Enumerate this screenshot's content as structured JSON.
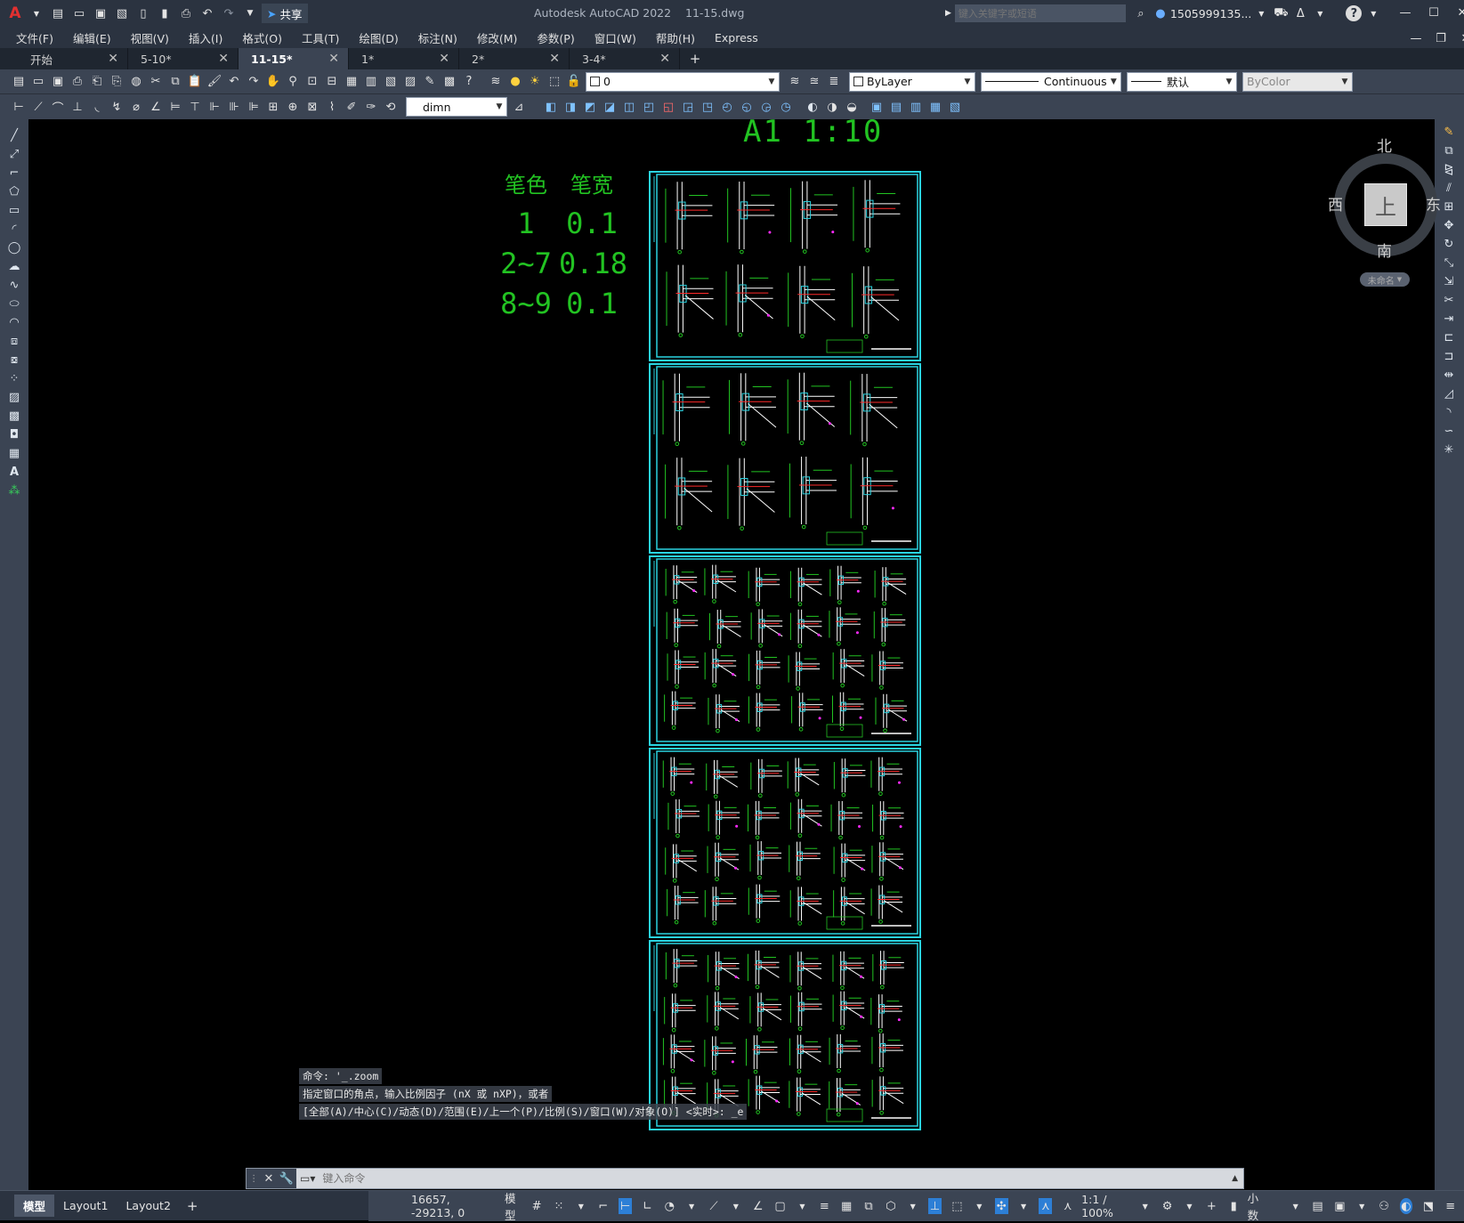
{
  "titlebar": {
    "app": "Autodesk AutoCAD 2022",
    "file": "11-15.dwg",
    "share": "共享",
    "search_placeholder": "键入关键字或短语",
    "user": "1505999135...",
    "help": "?"
  },
  "menu": [
    "文件(F)",
    "编辑(E)",
    "视图(V)",
    "插入(I)",
    "格式(O)",
    "工具(T)",
    "绘图(D)",
    "标注(N)",
    "修改(M)",
    "参数(P)",
    "窗口(W)",
    "帮助(H)",
    "Express"
  ],
  "tabs": [
    {
      "label": "开始"
    },
    {
      "label": "5-10*"
    },
    {
      "label": "11-15*",
      "active": true
    },
    {
      "label": "1*"
    },
    {
      "label": "2*"
    },
    {
      "label": "3-4*"
    }
  ],
  "toolbar": {
    "layer": "0",
    "color": "ByLayer",
    "linetype": "Continuous",
    "lineweight": "默认",
    "plotstyle": "ByColor",
    "dimstyle": "dimn"
  },
  "canvas": {
    "scale_title": "A1  1:10",
    "pen_header": [
      "笔色",
      "笔宽"
    ],
    "pen_rows": [
      [
        "1",
        "0.1"
      ],
      [
        "2~7",
        "0.18"
      ],
      [
        "8~9",
        "0.1"
      ]
    ]
  },
  "viewcube": {
    "north": "北",
    "south": "南",
    "east": "东",
    "west": "西",
    "top": "上",
    "ucs": "未命名"
  },
  "command": {
    "lines": [
      "命令: '_.zoom",
      "指定窗口的角点，输入比例因子 (nX 或 nXP)，或者",
      "[全部(A)/中心(C)/动态(D)/范围(E)/上一个(P)/比例(S)/窗口(W)/对象(O)] <实时>: _e"
    ],
    "placeholder": "键入命令"
  },
  "status": {
    "tabs": [
      "模型",
      "Layout1",
      "Layout2"
    ],
    "coords": "16657, -29213, 0",
    "space": "模型",
    "scale": "1:1 / 100%",
    "units": "小数"
  },
  "colors": {
    "accent": "#2ad3e0",
    "green": "#22c322",
    "panel": "#3b4453"
  }
}
